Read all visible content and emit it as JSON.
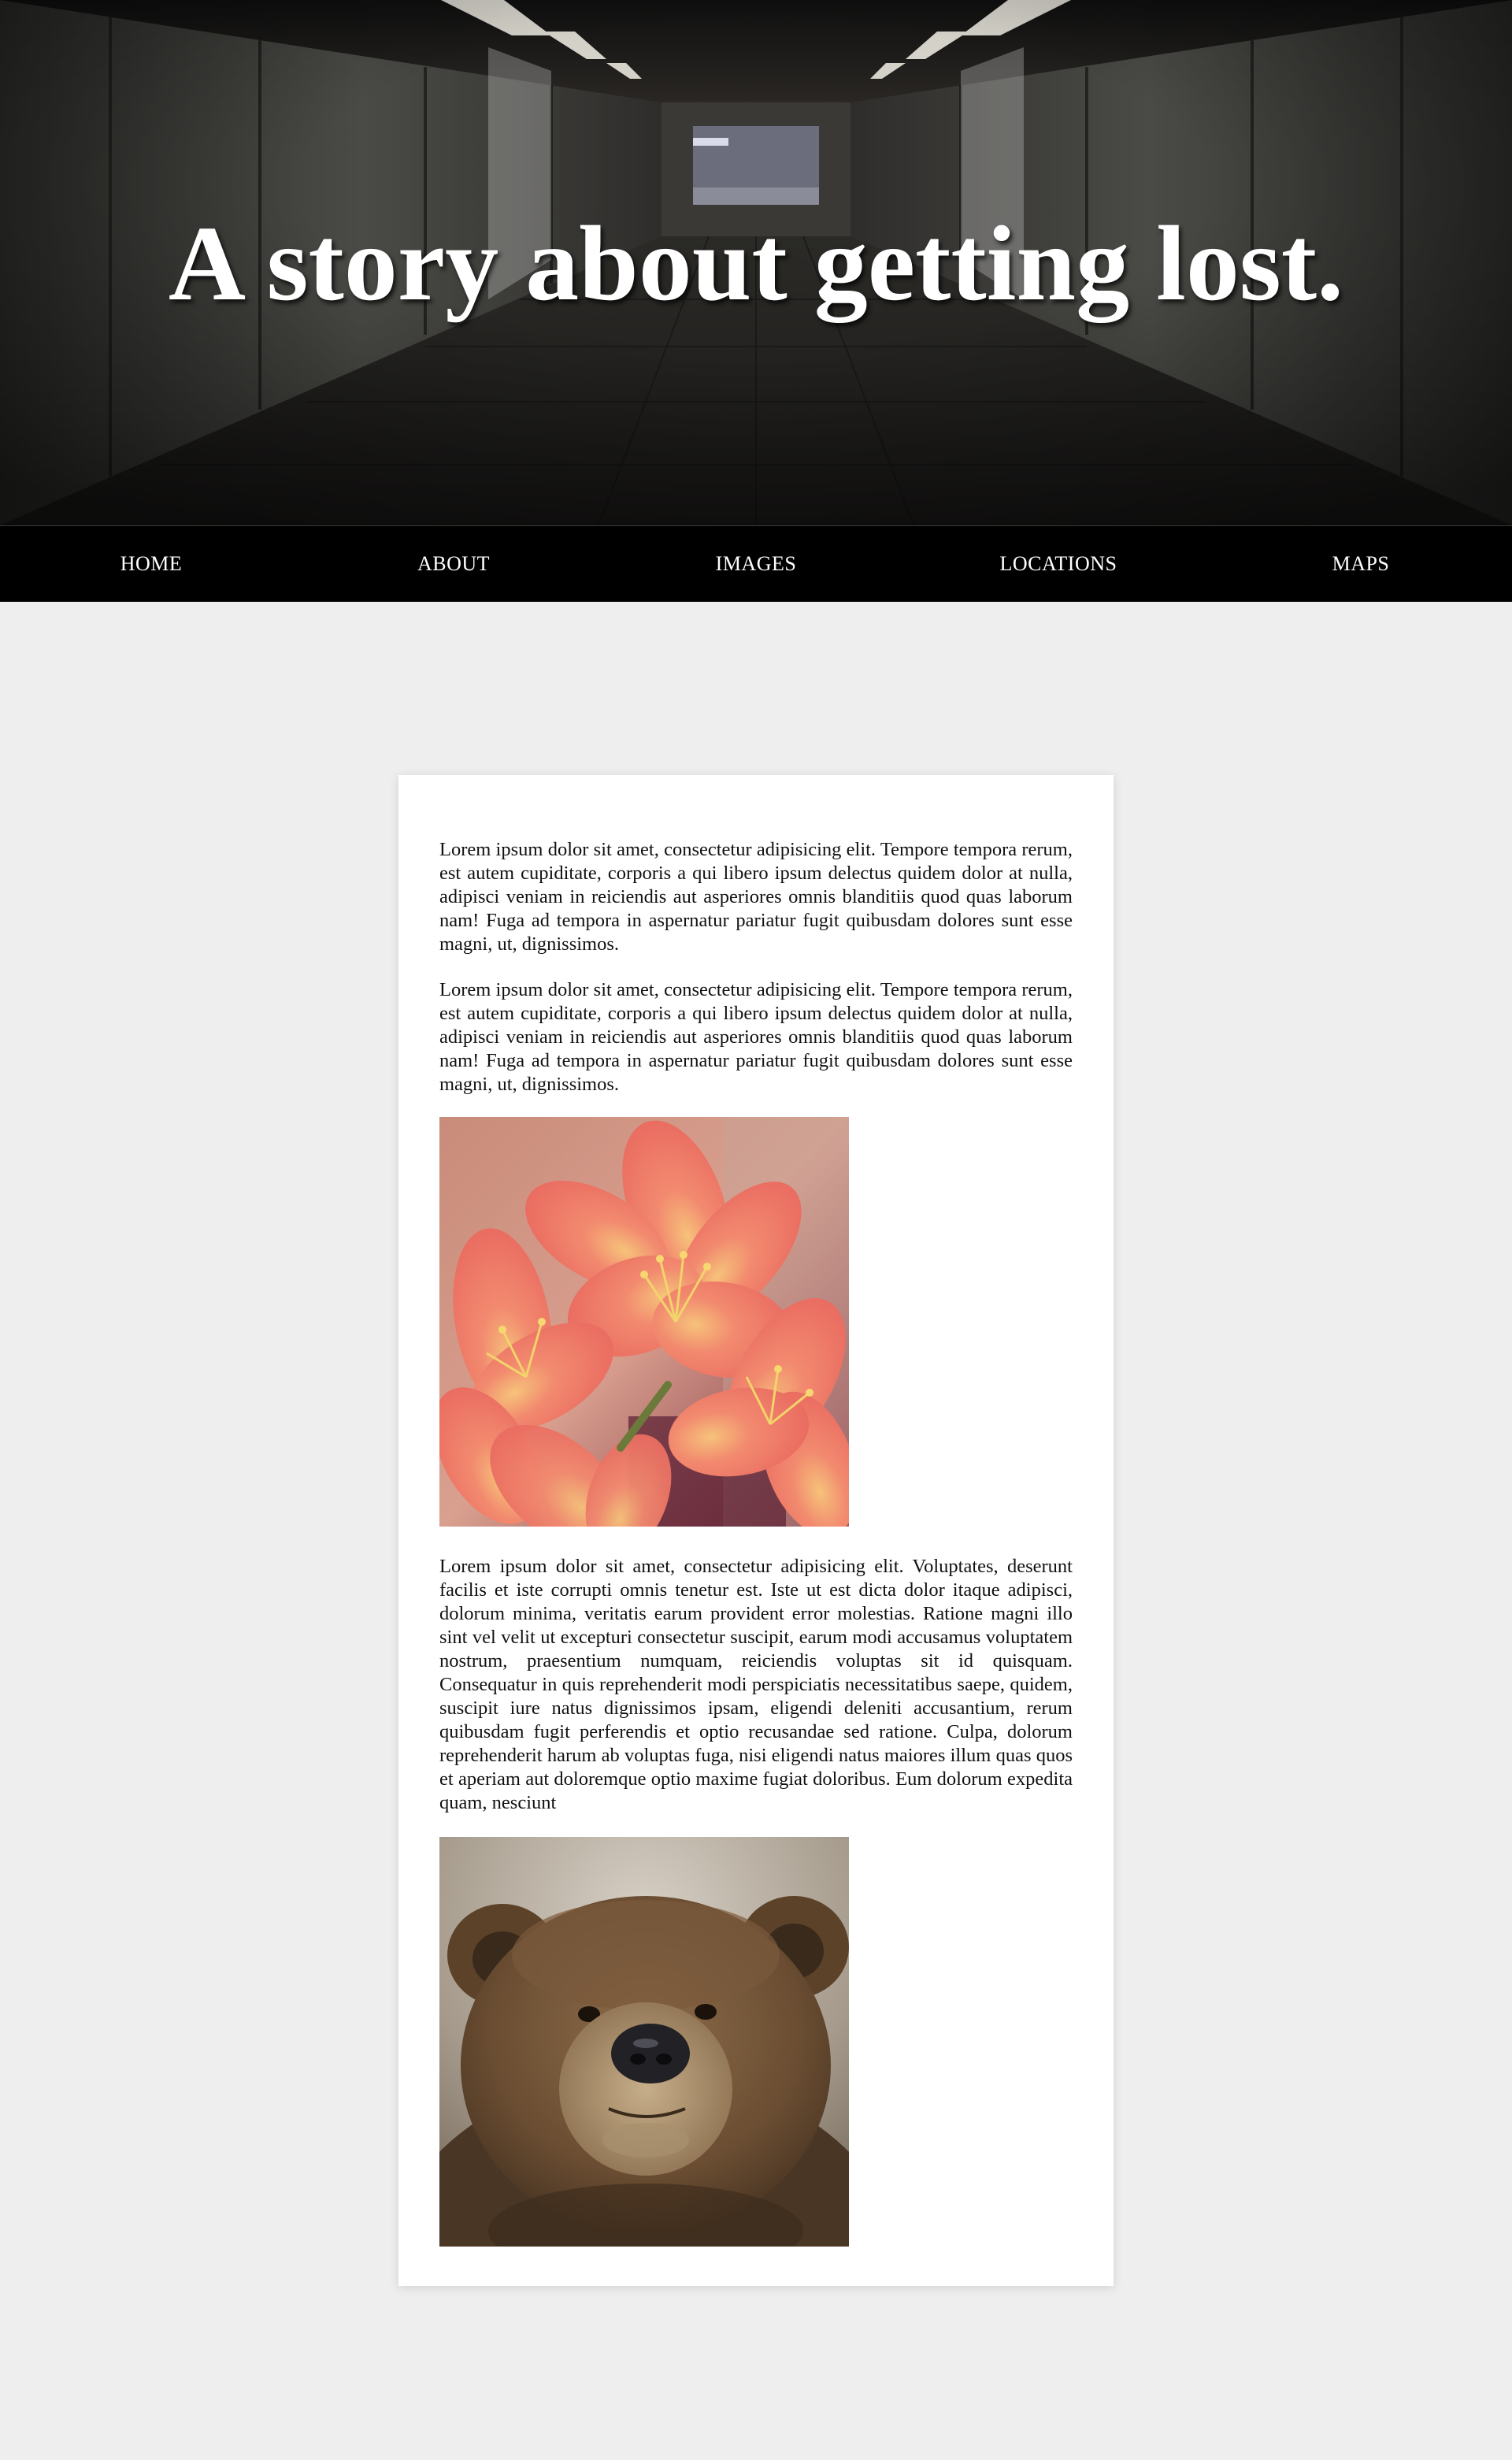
{
  "hero": {
    "title": "A story about getting lost."
  },
  "nav": {
    "items": [
      {
        "label": "HOME"
      },
      {
        "label": "ABOUT"
      },
      {
        "label": "IMAGES"
      },
      {
        "label": "LOCATIONS"
      },
      {
        "label": "MAPS"
      }
    ]
  },
  "article": {
    "paragraphs": [
      "Lorem ipsum dolor sit amet, consectetur adipisicing elit. Tempore tempora rerum, est autem cupiditate, corporis a qui libero ipsum delectus quidem dolor at nulla, adipisci veniam in reiciendis aut asperiores omnis blanditiis quod quas laborum nam! Fuga ad tempora in aspernatur pariatur fugit quibusdam dolores sunt esse magni, ut, dignissimos.",
      "Lorem ipsum dolor sit amet, consectetur adipisicing elit. Tempore tempora rerum, est autem cupiditate, corporis a qui libero ipsum delectus quidem dolor at nulla, adipisci veniam in reiciendis aut asperiores omnis blanditiis quod quas laborum nam! Fuga ad tempora in aspernatur pariatur fugit quibusdam dolores sunt esse magni, ut, dignissimos.",
      "Lorem ipsum dolor sit amet, consectetur adipisicing elit. Voluptates, deserunt facilis et iste corrupti omnis tenetur est. Iste ut est dicta dolor itaque adipisci, dolorum minima, veritatis earum provident error molestias. Ratione magni illo sint vel velit ut excepturi consectetur suscipit, earum modi accusamus voluptatem nostrum, praesentium numquam, reiciendis voluptas sit id quisquam. Consequatur in quis reprehenderit modi perspiciatis necessitatibus saepe, quidem, suscipit iure natus dignissimos ipsam, eligendi deleniti accusantium, rerum quibusdam fugit perferendis et optio recusandae sed ratione. Culpa, dolorum reprehenderit harum ab voluptas fuga, nisi eligendi natus maiores illum quas quos et aperiam aut doloremque optio maxime fugiat doloribus. Eum dolorum expedita quam, nesciunt"
    ]
  },
  "colors": {
    "page_background": "#eeeeee",
    "nav_background": "#000000",
    "card_background": "#ffffff",
    "text": "#111111"
  }
}
